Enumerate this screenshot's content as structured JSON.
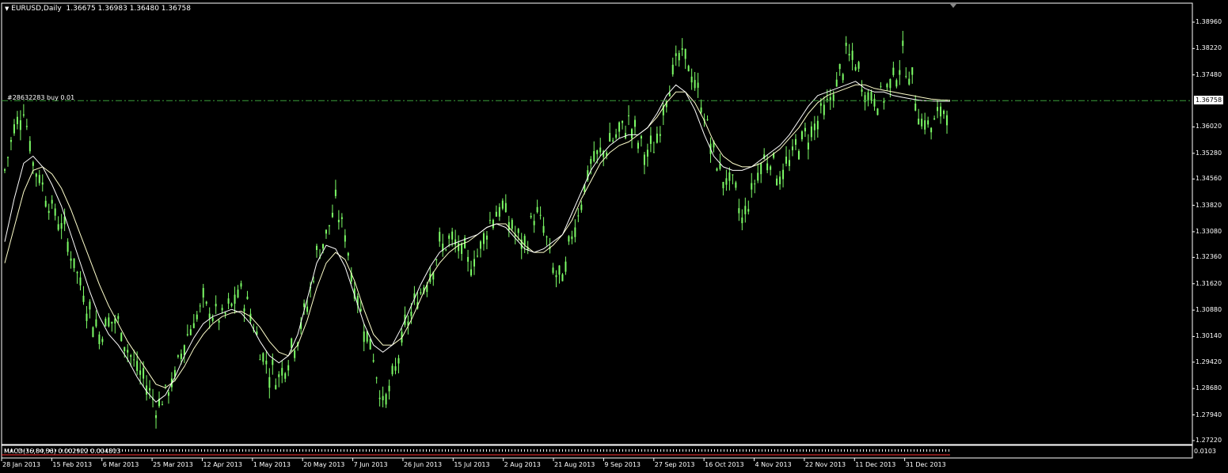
{
  "chart_header": {
    "symbol_timeframe": "EURUSD,Daily",
    "ohlc": "1.36675 1.36983 1.36480 1.36758",
    "dropdown_glyph": "▼"
  },
  "order_line": {
    "label": "#28632283 buy 0.01",
    "price": 1.36758
  },
  "current_price": {
    "label": "1.36758",
    "value": 1.36758
  },
  "macd": {
    "label": "MACD(36,84,36) 0.002922 0.004813",
    "scale_label": "0.0103"
  },
  "colors": {
    "background": "#000000",
    "bull_candle": "#7CFC66",
    "ma_fast": "#FFFFFF",
    "ma_slow": "#FFFFCC",
    "order_line": "#3BA03B",
    "macd_hist": "#FFFFFF",
    "macd_signal": "#FF3030",
    "axis": "#FFFFFF"
  },
  "y_axis_labels": [
    "1.38960",
    "1.38220",
    "1.37480",
    "1.36758",
    "1.36020",
    "1.35280",
    "1.34560",
    "1.33820",
    "1.33080",
    "1.32360",
    "1.31620",
    "1.30880",
    "1.30140",
    "1.29420",
    "1.28680",
    "1.27940",
    "1.27220"
  ],
  "x_axis_labels": [
    "28 Jan 2013",
    "15 Feb 2013",
    "6 Mar 2013",
    "25 Mar 2013",
    "12 Apr 2013",
    "1 May 2013",
    "20 May 2013",
    "7 Jun 2013",
    "26 Jun 2013",
    "15 Jul 2013",
    "2 Aug 2013",
    "21 Aug 2013",
    "9 Sep 2013",
    "27 Sep 2013",
    "16 Oct 2013",
    "4 Nov 2013",
    "22 Nov 2013",
    "11 Dec 2013",
    "31 Dec 2013"
  ],
  "chart_data": {
    "type": "line",
    "title": "EURUSD,Daily",
    "ylim": [
      1.2722,
      1.3896
    ],
    "x_labels": [
      "28 Jan 2013",
      "15 Feb 2013",
      "6 Mar 2013",
      "25 Mar 2013",
      "12 Apr 2013",
      "1 May 2013",
      "20 May 2013",
      "7 Jun 2013",
      "26 Jun 2013",
      "15 Jul 2013",
      "2 Aug 2013",
      "21 Aug 2013",
      "9 Sep 2013",
      "27 Sep 2013",
      "16 Oct 2013",
      "4 Nov 2013",
      "22 Nov 2013",
      "11 Dec 2013",
      "31 Dec 2013"
    ],
    "close": [
      1.348,
      1.36,
      1.366,
      1.35,
      1.344,
      1.337,
      1.333,
      1.325,
      1.316,
      1.308,
      1.302,
      1.306,
      1.305,
      1.298,
      1.292,
      1.288,
      1.282,
      1.285,
      1.29,
      1.3,
      1.306,
      1.31,
      1.308,
      1.306,
      1.31,
      1.314,
      1.308,
      1.298,
      1.292,
      1.29,
      1.296,
      1.302,
      1.31,
      1.324,
      1.33,
      1.338,
      1.33,
      1.315,
      1.305,
      1.296,
      1.282,
      1.288,
      1.3,
      1.308,
      1.314,
      1.32,
      1.326,
      1.328,
      1.326,
      1.322,
      1.324,
      1.332,
      1.337,
      1.336,
      1.33,
      1.326,
      1.336,
      1.332,
      1.32,
      1.316,
      1.33,
      1.34,
      1.35,
      1.352,
      1.356,
      1.358,
      1.362,
      1.356,
      1.352,
      1.356,
      1.37,
      1.378,
      1.38,
      1.372,
      1.364,
      1.352,
      1.346,
      1.344,
      1.334,
      1.342,
      1.35,
      1.352,
      1.346,
      1.35,
      1.356,
      1.358,
      1.362,
      1.366,
      1.372,
      1.38,
      1.378,
      1.37,
      1.368,
      1.369,
      1.374,
      1.38,
      1.372,
      1.362,
      1.36,
      1.364,
      1.3676
    ],
    "ma_fast": [
      1.328,
      1.34,
      1.35,
      1.352,
      1.349,
      1.344,
      1.338,
      1.33,
      1.322,
      1.314,
      1.307,
      1.302,
      1.299,
      1.295,
      1.29,
      1.286,
      1.283,
      1.285,
      1.29,
      1.296,
      1.301,
      1.305,
      1.307,
      1.308,
      1.309,
      1.308,
      1.305,
      1.3,
      1.296,
      1.294,
      1.296,
      1.302,
      1.312,
      1.322,
      1.327,
      1.326,
      1.321,
      1.313,
      1.305,
      1.299,
      1.297,
      1.299,
      1.304,
      1.31,
      1.316,
      1.321,
      1.325,
      1.327,
      1.328,
      1.329,
      1.33,
      1.332,
      1.333,
      1.332,
      1.329,
      1.326,
      1.325,
      1.326,
      1.328,
      1.33,
      1.336,
      1.342,
      1.348,
      1.352,
      1.355,
      1.357,
      1.358,
      1.358,
      1.36,
      1.364,
      1.369,
      1.372,
      1.37,
      1.365,
      1.358,
      1.352,
      1.349,
      1.348,
      1.348,
      1.349,
      1.351,
      1.353,
      1.355,
      1.358,
      1.362,
      1.366,
      1.369,
      1.37,
      1.371,
      1.372,
      1.373,
      1.371,
      1.37,
      1.37,
      1.369,
      1.3685,
      1.368,
      1.3676,
      1.3675,
      1.3674,
      1.3674
    ],
    "ma_slow": [
      1.322,
      1.332,
      1.342,
      1.348,
      1.349,
      1.347,
      1.343,
      1.337,
      1.33,
      1.323,
      1.316,
      1.31,
      1.305,
      1.3,
      1.296,
      1.292,
      1.288,
      1.287,
      1.289,
      1.293,
      1.298,
      1.302,
      1.305,
      1.307,
      1.308,
      1.3085,
      1.307,
      1.304,
      1.3,
      1.297,
      1.296,
      1.299,
      1.306,
      1.315,
      1.322,
      1.325,
      1.323,
      1.317,
      1.309,
      1.302,
      1.299,
      1.299,
      1.301,
      1.306,
      1.312,
      1.318,
      1.322,
      1.325,
      1.327,
      1.328,
      1.33,
      1.332,
      1.333,
      1.333,
      1.33,
      1.327,
      1.325,
      1.325,
      1.327,
      1.33,
      1.334,
      1.34,
      1.345,
      1.35,
      1.353,
      1.355,
      1.356,
      1.358,
      1.36,
      1.363,
      1.367,
      1.37,
      1.37,
      1.367,
      1.362,
      1.356,
      1.352,
      1.35,
      1.349,
      1.349,
      1.35,
      1.352,
      1.354,
      1.357,
      1.36,
      1.364,
      1.367,
      1.369,
      1.37,
      1.371,
      1.372,
      1.372,
      1.371,
      1.3705,
      1.37,
      1.3695,
      1.369,
      1.3685,
      1.368,
      1.3678,
      1.3677
    ]
  }
}
